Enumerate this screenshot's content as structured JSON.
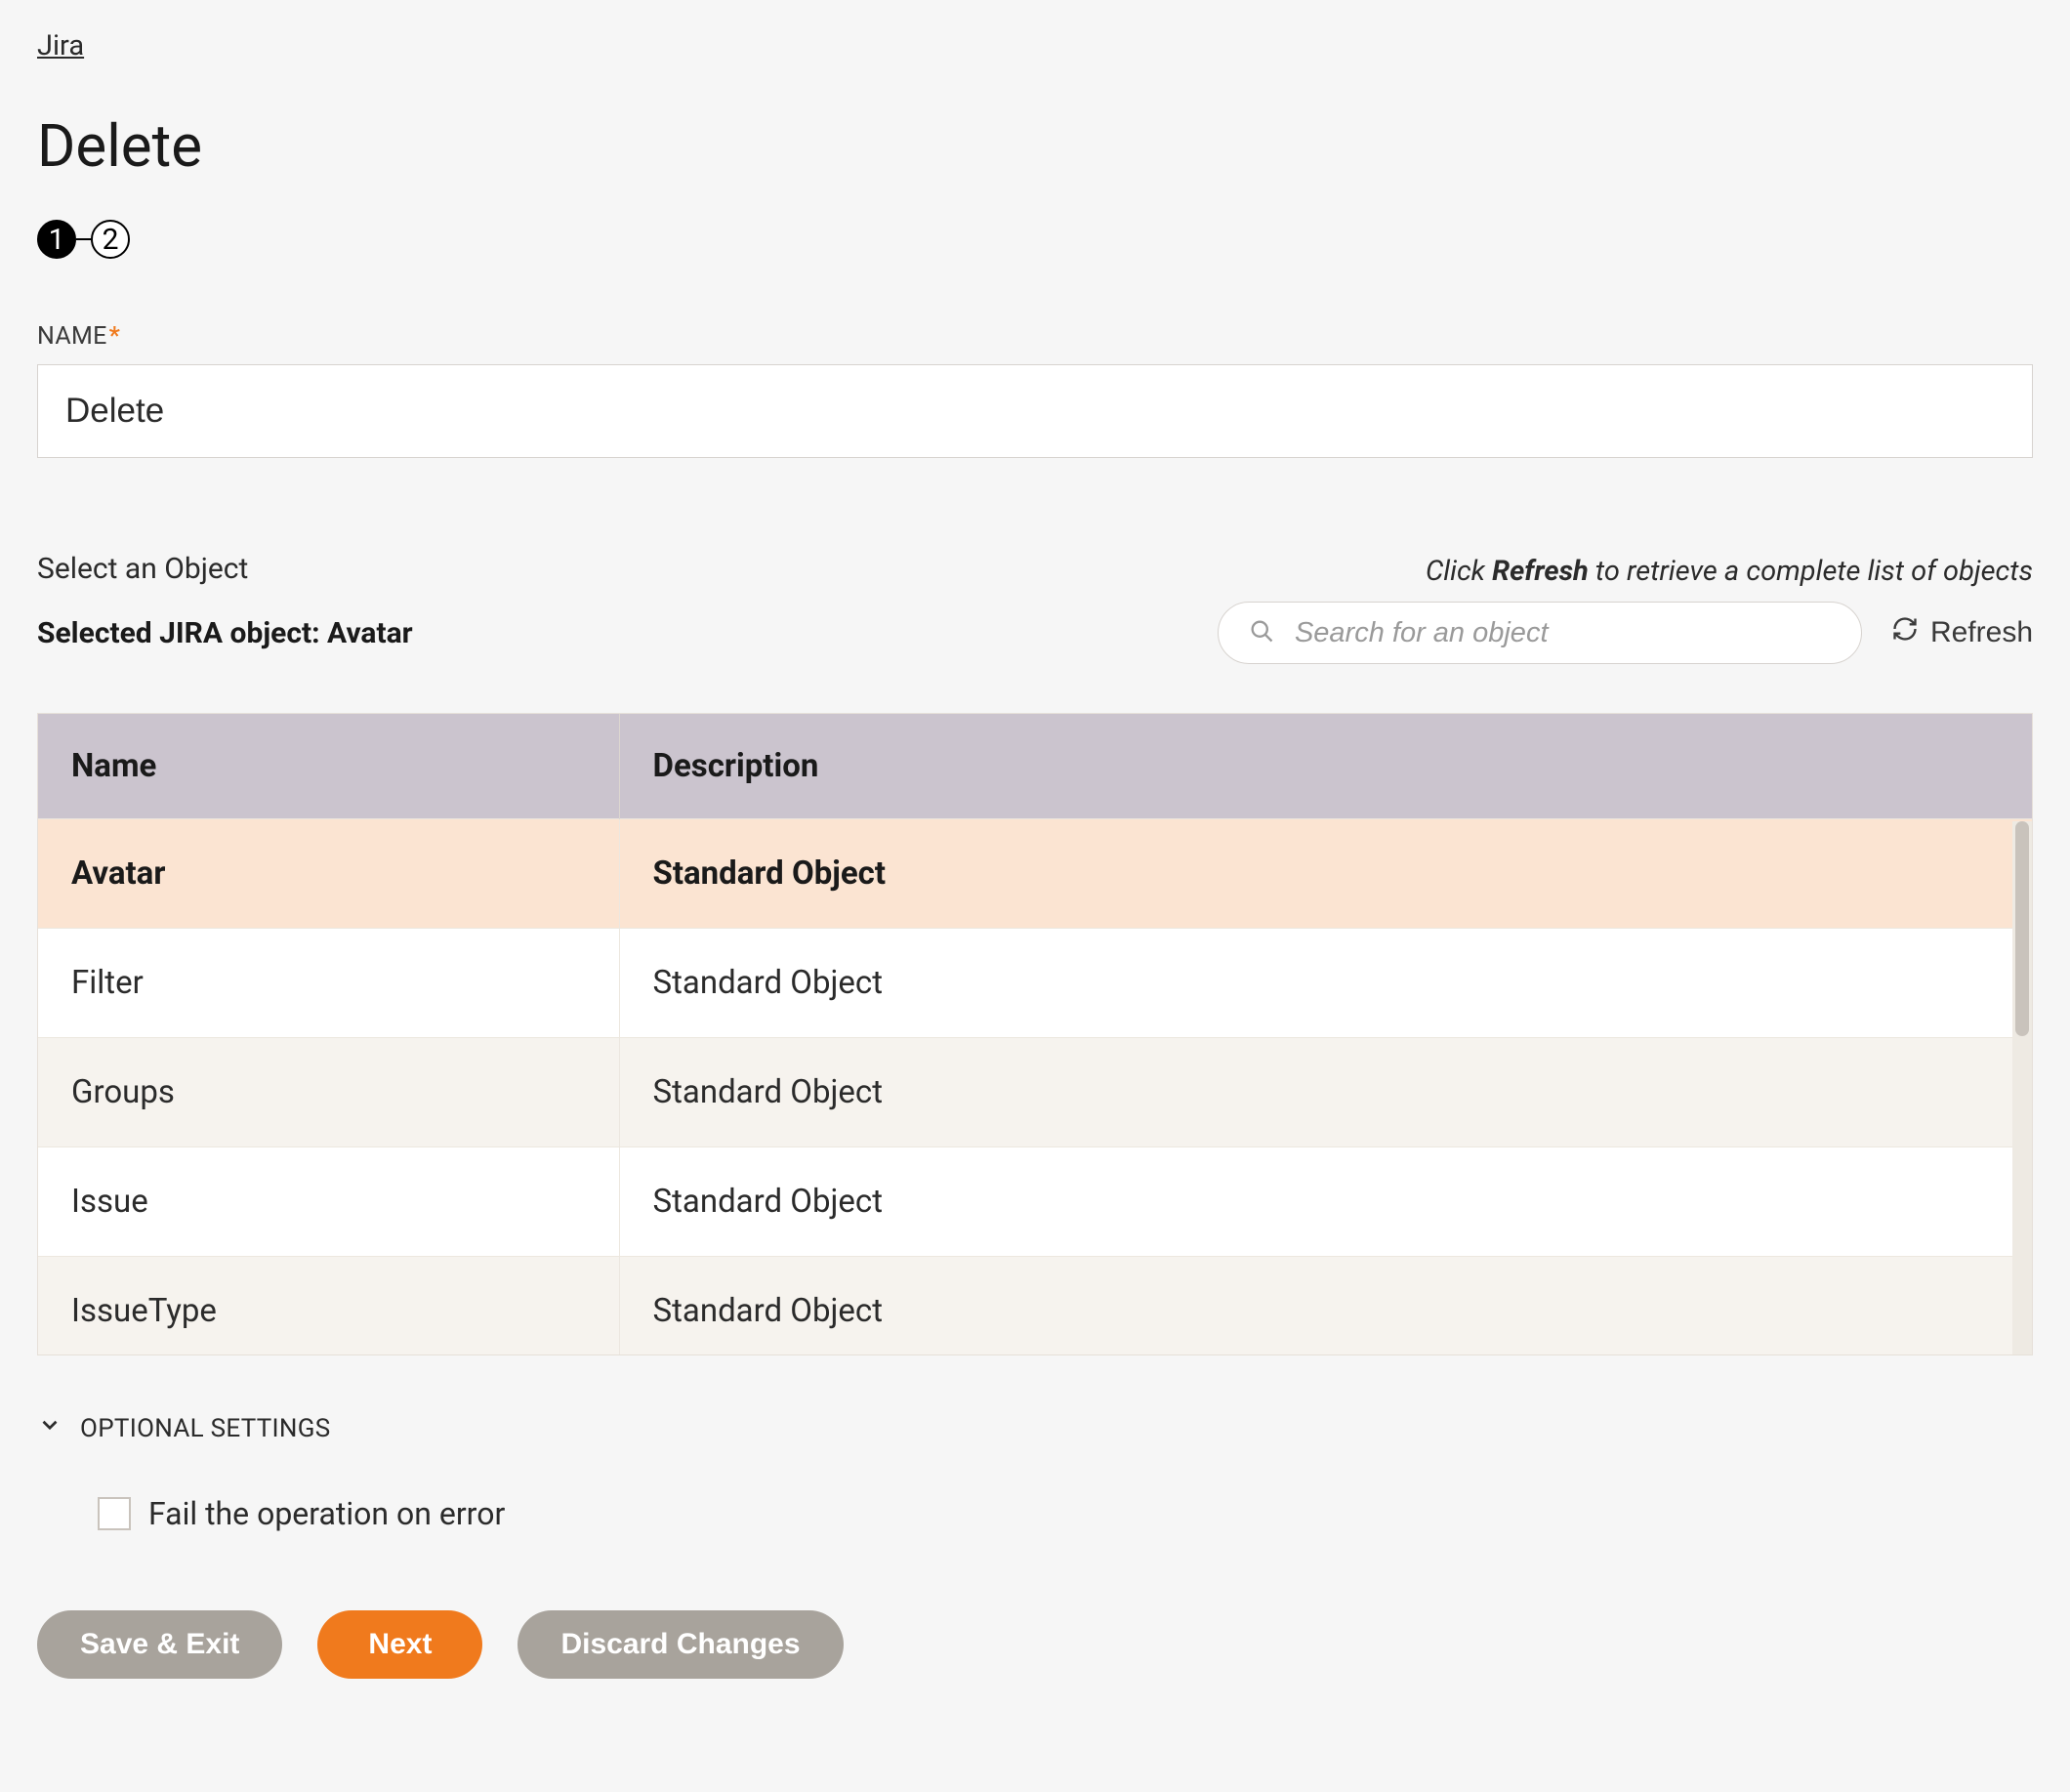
{
  "breadcrumb": {
    "label": "Jira"
  },
  "page_title": "Delete",
  "stepper": {
    "steps": [
      "1",
      "2"
    ],
    "active_index": 0
  },
  "name_field": {
    "label": "NAME",
    "required_mark": "*",
    "value": "Delete"
  },
  "select_object": {
    "section_label": "Select an Object",
    "selected_prefix": "Selected JIRA object:",
    "selected_value": "Avatar",
    "hint_prefix": "Click ",
    "hint_bold": "Refresh",
    "hint_suffix": " to retrieve a complete list of objects",
    "search_placeholder": "Search for an object",
    "refresh_label": "Refresh"
  },
  "table": {
    "columns": [
      "Name",
      "Description"
    ],
    "rows": [
      {
        "name": "Avatar",
        "description": "Standard Object",
        "selected": true
      },
      {
        "name": "Filter",
        "description": "Standard Object",
        "selected": false
      },
      {
        "name": "Groups",
        "description": "Standard Object",
        "selected": false
      },
      {
        "name": "Issue",
        "description": "Standard Object",
        "selected": false
      },
      {
        "name": "IssueType",
        "description": "Standard Object",
        "selected": false
      }
    ]
  },
  "optional": {
    "section_label": "OPTIONAL SETTINGS",
    "checkbox_label": "Fail the operation on error",
    "checkbox_checked": false
  },
  "buttons": {
    "save_exit": "Save & Exit",
    "next": "Next",
    "discard": "Discard Changes"
  }
}
